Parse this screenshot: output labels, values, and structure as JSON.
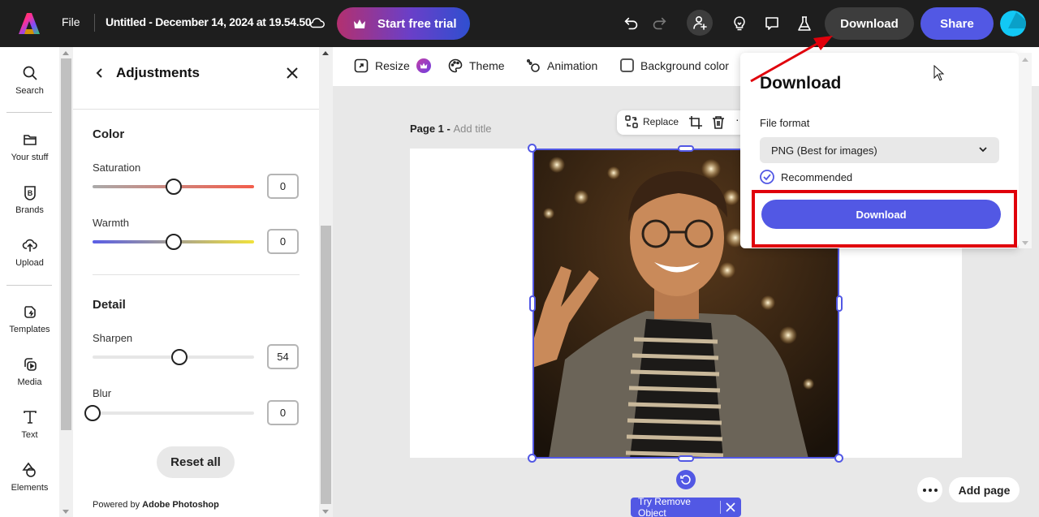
{
  "topbar": {
    "file_label": "File",
    "doc_title": "Untitled - December 14, 2024 at 19.54.50",
    "trial_button": "Start free trial",
    "download_button": "Download",
    "share_button": "Share",
    "icons": [
      "undo-icon",
      "redo-icon",
      "invite-user-icon",
      "lightbulb-icon",
      "comment-icon",
      "flask-icon"
    ]
  },
  "rail": {
    "items": [
      {
        "label": "Search",
        "icon": "search-icon"
      },
      {
        "label": "Your stuff",
        "icon": "folder-icon"
      },
      {
        "label": "Brands",
        "icon": "brand-icon"
      },
      {
        "label": "Upload",
        "icon": "upload-icon"
      },
      {
        "label": "Templates",
        "icon": "templates-icon"
      },
      {
        "label": "Media",
        "icon": "media-icon"
      },
      {
        "label": "Text",
        "icon": "text-icon"
      },
      {
        "label": "Elements",
        "icon": "elements-icon"
      }
    ]
  },
  "panel": {
    "title": "Adjustments",
    "sections": [
      {
        "title": "Color",
        "sliders": [
          {
            "label": "Saturation",
            "value": "0",
            "fraction": 0.5,
            "gradient": [
              "#aaaaaa",
              "#f35d4b"
            ]
          },
          {
            "label": "Warmth",
            "value": "0",
            "fraction": 0.5,
            "gradient": [
              "#5a5ee6",
              "#f1e23c"
            ]
          }
        ]
      },
      {
        "title": "Detail",
        "sliders": [
          {
            "label": "Sharpen",
            "value": "54",
            "fraction": 0.54,
            "gradient": [
              "#e6e6e6",
              "#e6e6e6"
            ]
          },
          {
            "label": "Blur",
            "value": "0",
            "fraction": 0.0,
            "gradient": [
              "#e6e6e6",
              "#e6e6e6"
            ]
          }
        ]
      }
    ],
    "reset_button": "Reset all",
    "powered_prefix": "Powered by",
    "powered_brand": "Adobe Photoshop"
  },
  "canvas_toolbar": {
    "resize": "Resize",
    "theme": "Theme",
    "animation": "Animation",
    "background_color": "Background color"
  },
  "canvas": {
    "page_label": "Page 1 - ",
    "page_title_placeholder": "Add title",
    "context_replace": "Replace",
    "try_remove_object": "Try Remove Object",
    "add_page": "Add page"
  },
  "download_popover": {
    "title": "Download",
    "file_format_label": "File format",
    "file_format_value": "PNG (Best for images)",
    "recommended": "Recommended",
    "download_button": "Download"
  },
  "colors": {
    "accent": "#5258e4",
    "topbar_bg": "#1e1e1e",
    "highlight": "#e0000b"
  }
}
